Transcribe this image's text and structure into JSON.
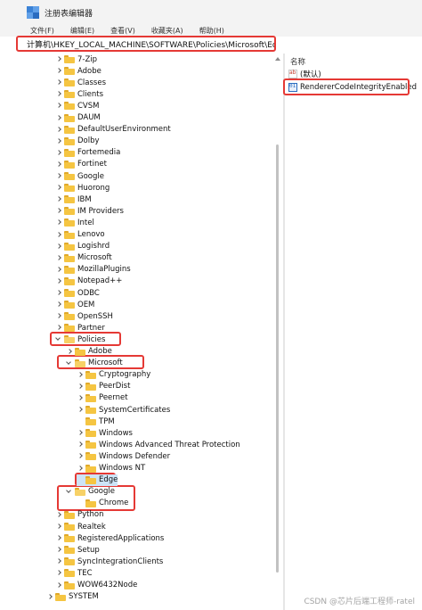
{
  "window": {
    "title": "注册表编辑器"
  },
  "menu": {
    "items": [
      "文件(F)",
      "编辑(E)",
      "查看(V)",
      "收藏夹(A)",
      "帮助(H)"
    ]
  },
  "address": {
    "path": "计算机\\HKEY_LOCAL_MACHINE\\SOFTWARE\\Policies\\Microsoft\\Edge"
  },
  "values_pane": {
    "column_name": "名称",
    "rows": [
      {
        "name": "(默认)",
        "icon": "string-value-icon"
      },
      {
        "name": "RendererCodeIntegrityEnabled",
        "icon": "binary-value-icon"
      }
    ]
  },
  "tree": [
    {
      "label": "7-Zip",
      "level": 1,
      "state": "collapsed"
    },
    {
      "label": "Adobe",
      "level": 1,
      "state": "collapsed"
    },
    {
      "label": "Classes",
      "level": 1,
      "state": "collapsed"
    },
    {
      "label": "Clients",
      "level": 1,
      "state": "collapsed"
    },
    {
      "label": "CVSM",
      "level": 1,
      "state": "collapsed"
    },
    {
      "label": "DAUM",
      "level": 1,
      "state": "collapsed"
    },
    {
      "label": "DefaultUserEnvironment",
      "level": 1,
      "state": "collapsed"
    },
    {
      "label": "Dolby",
      "level": 1,
      "state": "collapsed"
    },
    {
      "label": "Fortemedia",
      "level": 1,
      "state": "collapsed"
    },
    {
      "label": "Fortinet",
      "level": 1,
      "state": "collapsed"
    },
    {
      "label": "Google",
      "level": 1,
      "state": "collapsed"
    },
    {
      "label": "Huorong",
      "level": 1,
      "state": "collapsed"
    },
    {
      "label": "IBM",
      "level": 1,
      "state": "collapsed"
    },
    {
      "label": "IM Providers",
      "level": 1,
      "state": "collapsed"
    },
    {
      "label": "Intel",
      "level": 1,
      "state": "collapsed"
    },
    {
      "label": "Lenovo",
      "level": 1,
      "state": "collapsed"
    },
    {
      "label": "Logishrd",
      "level": 1,
      "state": "collapsed"
    },
    {
      "label": "Microsoft",
      "level": 1,
      "state": "collapsed"
    },
    {
      "label": "MozillaPlugins",
      "level": 1,
      "state": "collapsed"
    },
    {
      "label": "Notepad++",
      "level": 1,
      "state": "collapsed"
    },
    {
      "label": "ODBC",
      "level": 1,
      "state": "collapsed"
    },
    {
      "label": "OEM",
      "level": 1,
      "state": "collapsed"
    },
    {
      "label": "OpenSSH",
      "level": 1,
      "state": "collapsed"
    },
    {
      "label": "Partner",
      "level": 1,
      "state": "collapsed"
    },
    {
      "label": "Policies",
      "level": 1,
      "state": "expanded"
    },
    {
      "label": "Adobe",
      "level": 2,
      "state": "collapsed"
    },
    {
      "label": "Microsoft",
      "level": 2,
      "state": "expanded"
    },
    {
      "label": "Cryptography",
      "level": 3,
      "state": "collapsed"
    },
    {
      "label": "PeerDist",
      "level": 3,
      "state": "collapsed"
    },
    {
      "label": "Peernet",
      "level": 3,
      "state": "collapsed"
    },
    {
      "label": "SystemCertificates",
      "level": 3,
      "state": "collapsed"
    },
    {
      "label": "TPM",
      "level": 3,
      "state": "none"
    },
    {
      "label": "Windows",
      "level": 3,
      "state": "collapsed"
    },
    {
      "label": "Windows Advanced Threat Protection",
      "level": 3,
      "state": "collapsed"
    },
    {
      "label": "Windows Defender",
      "level": 3,
      "state": "collapsed"
    },
    {
      "label": "Windows NT",
      "level": 3,
      "state": "collapsed"
    },
    {
      "label": "Edge",
      "level": 3,
      "state": "none",
      "selected": true
    },
    {
      "label": "Google",
      "level": 2,
      "state": "expanded"
    },
    {
      "label": "Chrome",
      "level": 3,
      "state": "none"
    },
    {
      "label": "Python",
      "level": 1,
      "state": "collapsed"
    },
    {
      "label": "Realtek",
      "level": 1,
      "state": "collapsed"
    },
    {
      "label": "RegisteredApplications",
      "level": 1,
      "state": "collapsed"
    },
    {
      "label": "Setup",
      "level": 1,
      "state": "collapsed"
    },
    {
      "label": "SyncIntegrationClients",
      "level": 1,
      "state": "collapsed"
    },
    {
      "label": "TEC",
      "level": 1,
      "state": "collapsed"
    },
    {
      "label": "WOW6432Node",
      "level": 1,
      "state": "collapsed"
    },
    {
      "label": "SYSTEM",
      "level": 0,
      "state": "collapsed"
    }
  ],
  "watermark": "CSDN @芯片后端工程师-ratel",
  "colors": {
    "highlight_box": "#e53935",
    "selection": "#cde4f7",
    "folder": "#f5c542"
  }
}
